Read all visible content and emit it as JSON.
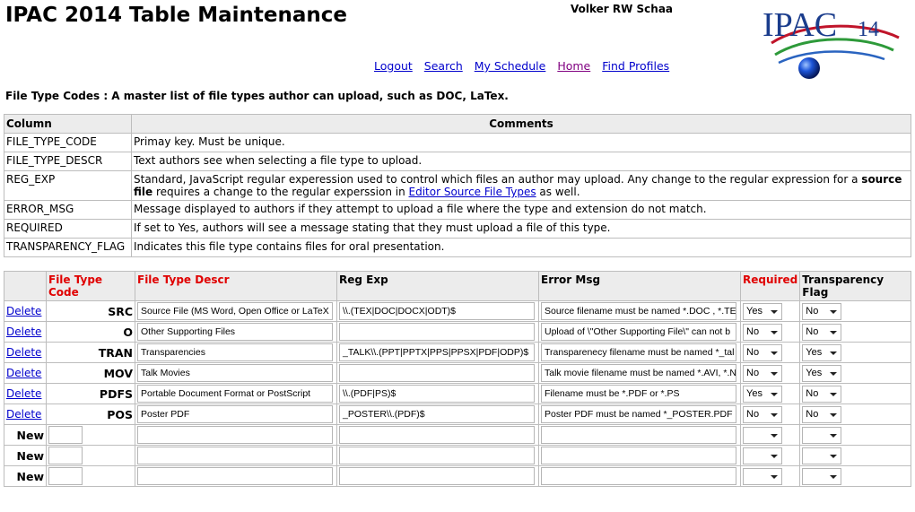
{
  "page": {
    "title": "IPAC 2014 Table Maintenance",
    "user": "Volker RW Schaa",
    "logo_text": "IPAC",
    "logo_sub": "14",
    "nav": [
      "Logout",
      "Search",
      "My Schedule",
      "Home",
      "Find Profiles"
    ],
    "intro": "File Type Codes :  A master list of file types author can upload, such as DOC, LaTex."
  },
  "columns_table": {
    "headers": [
      "Column",
      "Comments"
    ],
    "rows": [
      {
        "column": "FILE_TYPE_CODE",
        "comment": "Primay key. Must be unique."
      },
      {
        "column": "FILE_TYPE_DESCR",
        "comment": "Text authors see when selecting a file type to upload."
      },
      {
        "column": "REG_EXP",
        "comment_a": "Standard, JavaScript regular experession used to control which files an author may upload. Any change to the regular expression for a",
        "comment_bold": "source file",
        "comment_b": "requires a change to the regular experssion in",
        "comment_link": "Editor Source File Types",
        "comment_c": "as well."
      },
      {
        "column": "ERROR_MSG",
        "comment": "Message displayed to authors if they attempt to upload a file where the type and extension do not match."
      },
      {
        "column": "REQUIRED",
        "comment": "If set to Yes, authors will see a message stating that they must upload a file of this type."
      },
      {
        "column": "TRANSPARENCY_FLAG",
        "comment": "Indicates this file type contains files for oral presentation."
      }
    ]
  },
  "grid": {
    "headers": {
      "code": "File Type Code",
      "descr": "File Type Descr",
      "regexp": "Reg Exp",
      "error": "Error Msg",
      "required": "Required",
      "transparency": "Transparency Flag"
    },
    "delete_label": "Delete",
    "new_label": "New",
    "rows": [
      {
        "code": "SRC",
        "descr": "Source File (MS Word, Open Office or LaTeX",
        "regexp": "\\\\.(TEX|DOC|DOCX|ODT)$",
        "error": "Source filename must be named *.DOC , *.TE",
        "required": "Yes",
        "transparency": "No"
      },
      {
        "code": "O",
        "descr": "Other Supporting Files",
        "regexp": "",
        "error": "Upload of \\\"Other Supporting File\\\" can not b",
        "required": "No",
        "transparency": "No"
      },
      {
        "code": "TRAN",
        "descr": "Transparencies",
        "regexp": "_TALK\\\\.(PPT|PPTX|PPS|PPSX|PDF|ODP)$",
        "error": "Transparenecy filename must be named *_tal",
        "required": "No",
        "transparency": "Yes"
      },
      {
        "code": "MOV",
        "descr": "Talk Movies",
        "regexp": "",
        "error": "Talk movie filename must be named *.AVI, *.N",
        "required": "No",
        "transparency": "Yes"
      },
      {
        "code": "PDFS",
        "descr": "Portable Document Format or PostScript",
        "regexp": "\\\\.(PDF|PS)$",
        "error": "Filename must be *.PDF or *.PS",
        "required": "Yes",
        "transparency": "No"
      },
      {
        "code": "POS",
        "descr": "Poster PDF",
        "regexp": "_POSTER\\\\.(PDF)$",
        "error": "Poster PDF must be named *_POSTER.PDF",
        "required": "No",
        "transparency": "No"
      }
    ],
    "new_rows": 3
  },
  "colors": {
    "link": "#0000cc",
    "visited": "#800080",
    "required_header": "#e00000",
    "header_bg": "#ececec",
    "logo_blue": "#1a3c8c"
  }
}
